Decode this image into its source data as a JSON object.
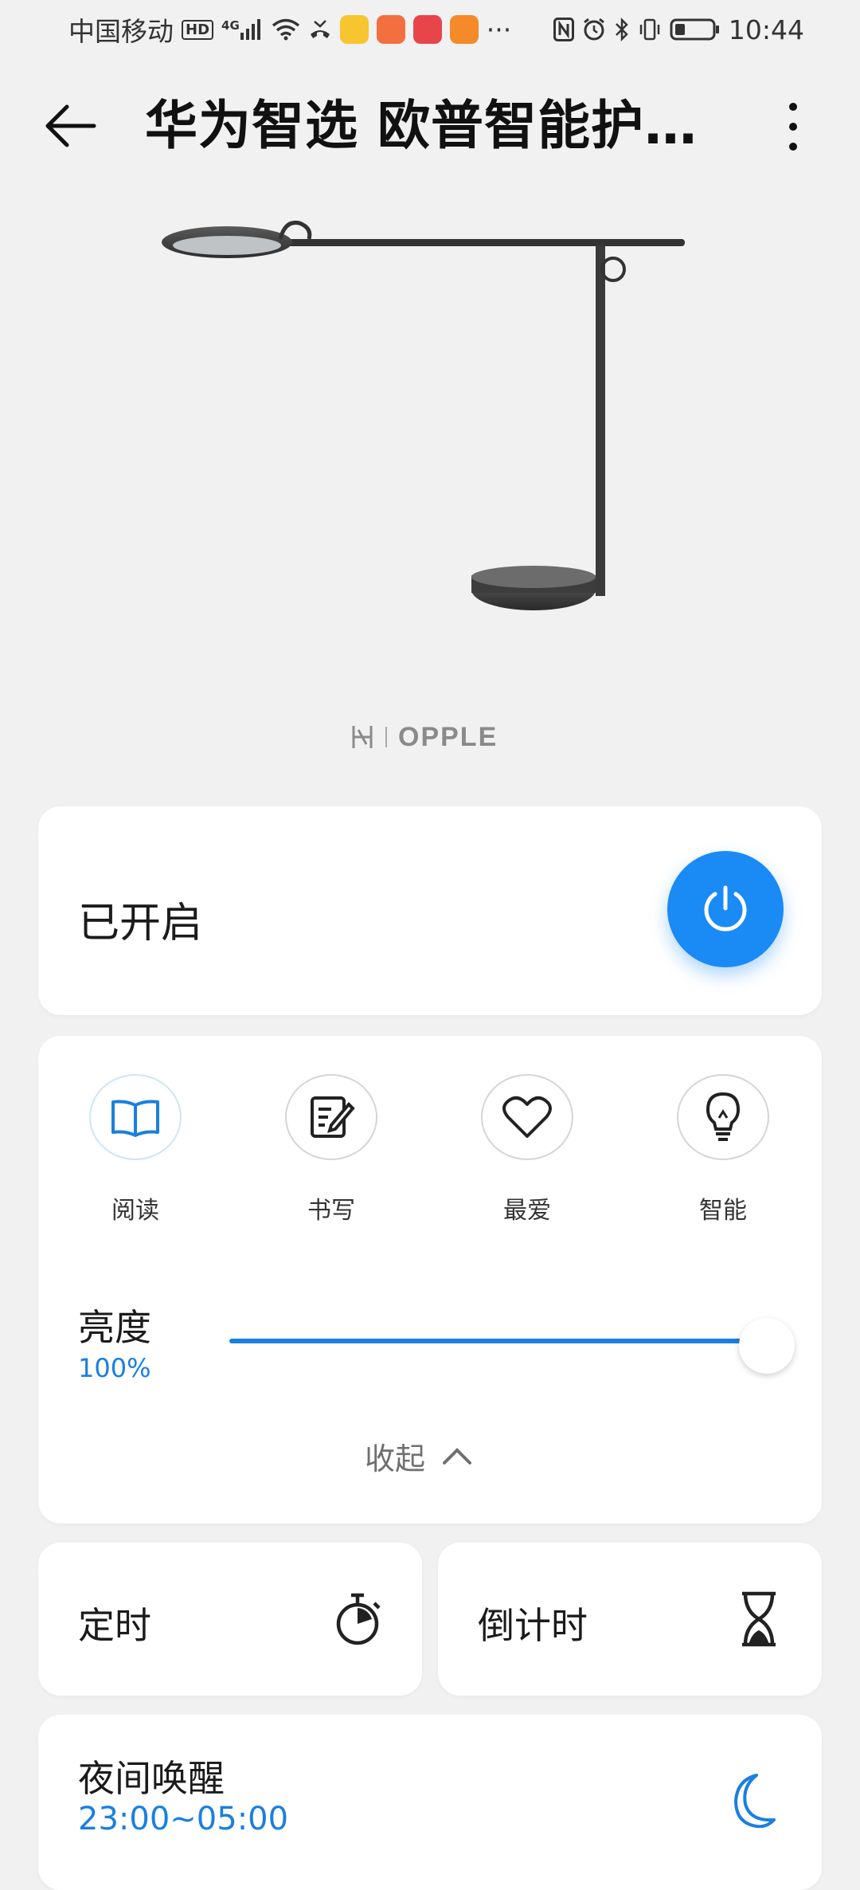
{
  "status_bar": {
    "carrier": "中国移动",
    "network": "HD",
    "signal_type": "4G",
    "time": "10:44",
    "dots": "···"
  },
  "header": {
    "title": "华为智选 欧普智能护眼台灯",
    "back_icon": "arrow-left-icon",
    "more_icon": "more-vertical-icon"
  },
  "brand": {
    "logo_text": "OPPLE"
  },
  "power": {
    "label": "已开启",
    "state": "on",
    "button_color": "#1a8af5"
  },
  "modes": [
    {
      "label": "阅读",
      "icon": "book-icon",
      "active": true
    },
    {
      "label": "书写",
      "icon": "write-icon",
      "active": false
    },
    {
      "label": "最爱",
      "icon": "heart-icon",
      "active": false
    },
    {
      "label": "智能",
      "icon": "bulb-icon",
      "active": false
    }
  ],
  "brightness": {
    "label": "亮度",
    "value_text": "100%",
    "value": 100
  },
  "collapse": {
    "label": "收起"
  },
  "timer": {
    "label": "定时",
    "icon": "stopwatch-icon"
  },
  "countdown": {
    "label": "倒计时",
    "icon": "hourglass-icon"
  },
  "night_wake": {
    "label": "夜间唤醒",
    "time": "23:00~05:00",
    "icon": "moon-icon"
  },
  "colors": {
    "accent": "#1a7fe0",
    "background": "#f1f1f1"
  }
}
